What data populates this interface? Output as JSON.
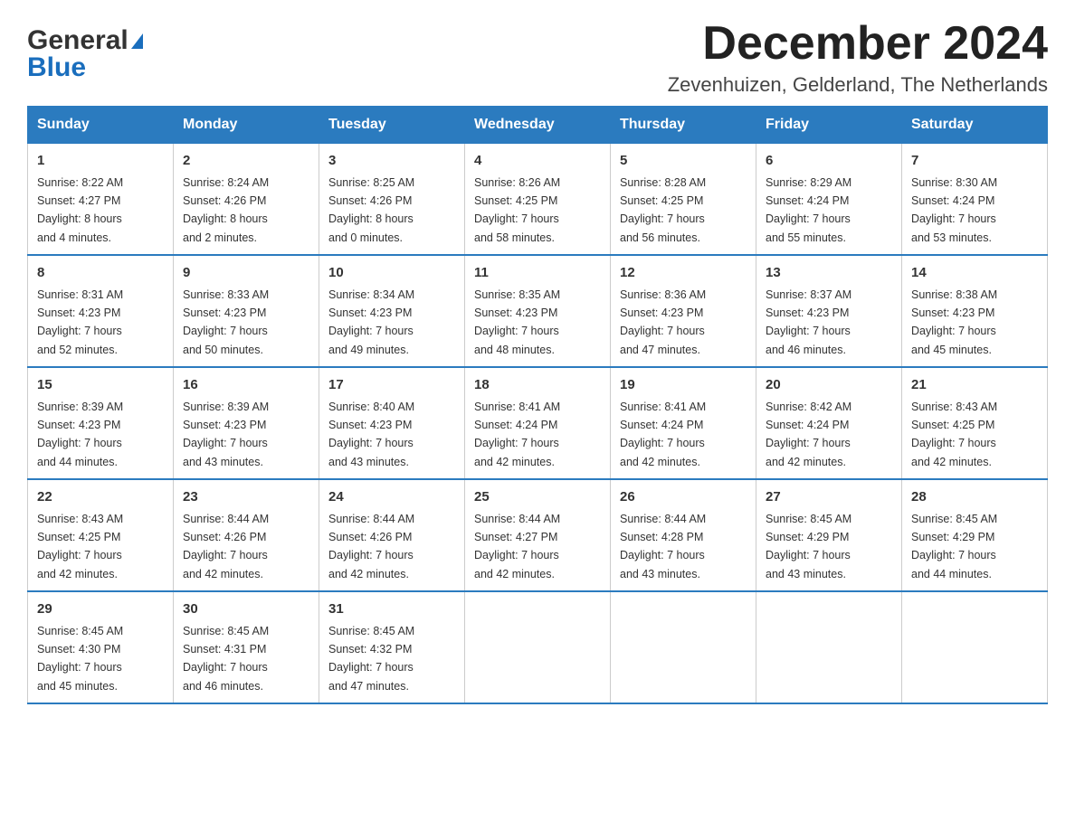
{
  "header": {
    "logo_line1": "General",
    "logo_line2": "Blue",
    "month_title": "December 2024",
    "location": "Zevenhuizen, Gelderland, The Netherlands"
  },
  "days_of_week": [
    "Sunday",
    "Monday",
    "Tuesday",
    "Wednesday",
    "Thursday",
    "Friday",
    "Saturday"
  ],
  "weeks": [
    [
      {
        "day": "1",
        "sunrise": "8:22 AM",
        "sunset": "4:27 PM",
        "daylight": "8 hours and 4 minutes."
      },
      {
        "day": "2",
        "sunrise": "8:24 AM",
        "sunset": "4:26 PM",
        "daylight": "8 hours and 2 minutes."
      },
      {
        "day": "3",
        "sunrise": "8:25 AM",
        "sunset": "4:26 PM",
        "daylight": "8 hours and 0 minutes."
      },
      {
        "day": "4",
        "sunrise": "8:26 AM",
        "sunset": "4:25 PM",
        "daylight": "7 hours and 58 minutes."
      },
      {
        "day": "5",
        "sunrise": "8:28 AM",
        "sunset": "4:25 PM",
        "daylight": "7 hours and 56 minutes."
      },
      {
        "day": "6",
        "sunrise": "8:29 AM",
        "sunset": "4:24 PM",
        "daylight": "7 hours and 55 minutes."
      },
      {
        "day": "7",
        "sunrise": "8:30 AM",
        "sunset": "4:24 PM",
        "daylight": "7 hours and 53 minutes."
      }
    ],
    [
      {
        "day": "8",
        "sunrise": "8:31 AM",
        "sunset": "4:23 PM",
        "daylight": "7 hours and 52 minutes."
      },
      {
        "day": "9",
        "sunrise": "8:33 AM",
        "sunset": "4:23 PM",
        "daylight": "7 hours and 50 minutes."
      },
      {
        "day": "10",
        "sunrise": "8:34 AM",
        "sunset": "4:23 PM",
        "daylight": "7 hours and 49 minutes."
      },
      {
        "day": "11",
        "sunrise": "8:35 AM",
        "sunset": "4:23 PM",
        "daylight": "7 hours and 48 minutes."
      },
      {
        "day": "12",
        "sunrise": "8:36 AM",
        "sunset": "4:23 PM",
        "daylight": "7 hours and 47 minutes."
      },
      {
        "day": "13",
        "sunrise": "8:37 AM",
        "sunset": "4:23 PM",
        "daylight": "7 hours and 46 minutes."
      },
      {
        "day": "14",
        "sunrise": "8:38 AM",
        "sunset": "4:23 PM",
        "daylight": "7 hours and 45 minutes."
      }
    ],
    [
      {
        "day": "15",
        "sunrise": "8:39 AM",
        "sunset": "4:23 PM",
        "daylight": "7 hours and 44 minutes."
      },
      {
        "day": "16",
        "sunrise": "8:39 AM",
        "sunset": "4:23 PM",
        "daylight": "7 hours and 43 minutes."
      },
      {
        "day": "17",
        "sunrise": "8:40 AM",
        "sunset": "4:23 PM",
        "daylight": "7 hours and 43 minutes."
      },
      {
        "day": "18",
        "sunrise": "8:41 AM",
        "sunset": "4:24 PM",
        "daylight": "7 hours and 42 minutes."
      },
      {
        "day": "19",
        "sunrise": "8:41 AM",
        "sunset": "4:24 PM",
        "daylight": "7 hours and 42 minutes."
      },
      {
        "day": "20",
        "sunrise": "8:42 AM",
        "sunset": "4:24 PM",
        "daylight": "7 hours and 42 minutes."
      },
      {
        "day": "21",
        "sunrise": "8:43 AM",
        "sunset": "4:25 PM",
        "daylight": "7 hours and 42 minutes."
      }
    ],
    [
      {
        "day": "22",
        "sunrise": "8:43 AM",
        "sunset": "4:25 PM",
        "daylight": "7 hours and 42 minutes."
      },
      {
        "day": "23",
        "sunrise": "8:44 AM",
        "sunset": "4:26 PM",
        "daylight": "7 hours and 42 minutes."
      },
      {
        "day": "24",
        "sunrise": "8:44 AM",
        "sunset": "4:26 PM",
        "daylight": "7 hours and 42 minutes."
      },
      {
        "day": "25",
        "sunrise": "8:44 AM",
        "sunset": "4:27 PM",
        "daylight": "7 hours and 42 minutes."
      },
      {
        "day": "26",
        "sunrise": "8:44 AM",
        "sunset": "4:28 PM",
        "daylight": "7 hours and 43 minutes."
      },
      {
        "day": "27",
        "sunrise": "8:45 AM",
        "sunset": "4:29 PM",
        "daylight": "7 hours and 43 minutes."
      },
      {
        "day": "28",
        "sunrise": "8:45 AM",
        "sunset": "4:29 PM",
        "daylight": "7 hours and 44 minutes."
      }
    ],
    [
      {
        "day": "29",
        "sunrise": "8:45 AM",
        "sunset": "4:30 PM",
        "daylight": "7 hours and 45 minutes."
      },
      {
        "day": "30",
        "sunrise": "8:45 AM",
        "sunset": "4:31 PM",
        "daylight": "7 hours and 46 minutes."
      },
      {
        "day": "31",
        "sunrise": "8:45 AM",
        "sunset": "4:32 PM",
        "daylight": "7 hours and 47 minutes."
      },
      null,
      null,
      null,
      null
    ]
  ],
  "labels": {
    "sunrise": "Sunrise:",
    "sunset": "Sunset:",
    "daylight": "Daylight:"
  }
}
